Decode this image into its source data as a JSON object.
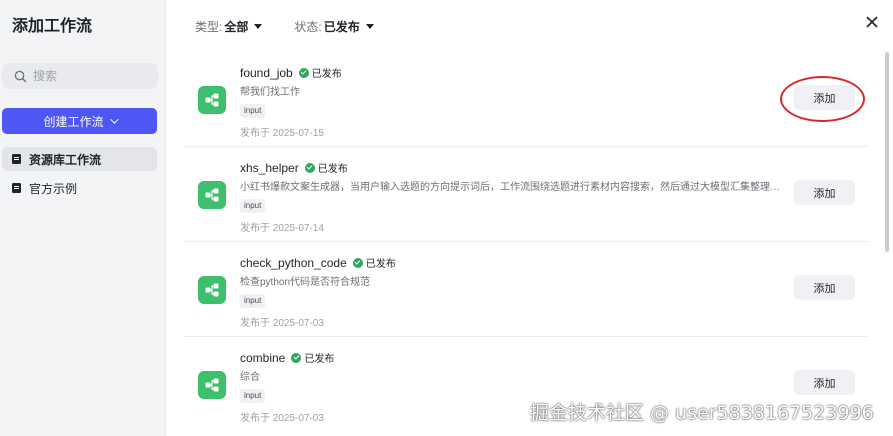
{
  "sidebar": {
    "title": "添加工作流",
    "search_placeholder": "搜索",
    "create_label": "创建工作流",
    "nav": [
      {
        "label": "资源库工作流"
      },
      {
        "label": "官方示例"
      }
    ]
  },
  "filters": [
    {
      "label": "类型:",
      "value": "全部"
    },
    {
      "label": "状态:",
      "value": "已发布"
    }
  ],
  "workflows": [
    {
      "name": "found_job",
      "status": "已发布",
      "description": "帮我们找工作",
      "tag": "input",
      "date": "发布于 2025-07-15",
      "action": "添加"
    },
    {
      "name": "xhs_helper",
      "status": "已发布",
      "description": "小红书爆款文案生成器，当用户输入选题的方向提示词后，工作流围绕选题进行素材内容搜索，然后通过大模型汇集整理成...",
      "tag": "input",
      "date": "发布于 2025-07-14",
      "action": "添加"
    },
    {
      "name": "check_python_code",
      "status": "已发布",
      "description": "检查python代码是否符合规范",
      "tag": "input",
      "date": "发布于 2025-07-03",
      "action": "添加"
    },
    {
      "name": "combine",
      "status": "已发布",
      "description": "综合",
      "tag": "input",
      "date": "发布于 2025-07-03",
      "action": "添加"
    }
  ],
  "watermark": "掘金技术社区 @ user5838167523996",
  "colors": {
    "primary": "#4e56f6",
    "workflow_icon": "#3ebf6c",
    "published": "#2fa85c",
    "annotation": "#d8282e"
  }
}
